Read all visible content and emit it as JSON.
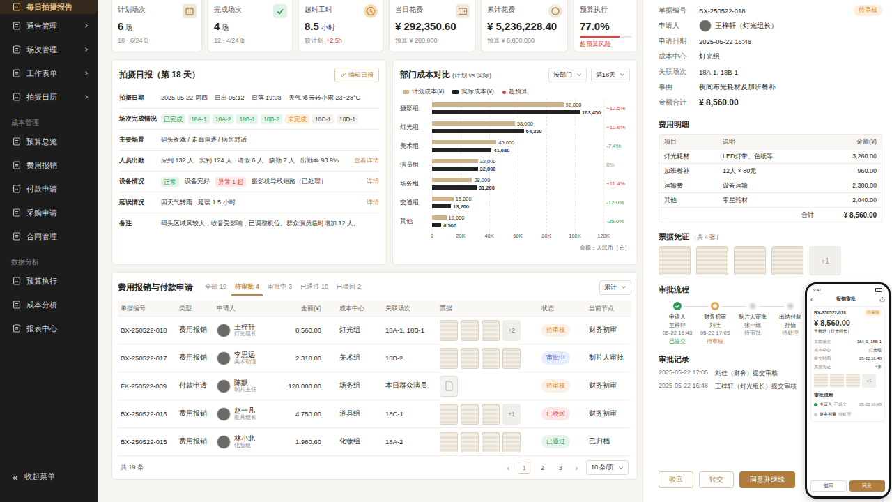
{
  "sidebar": {
    "top_items": [
      {
        "label": "每日拍摄报告",
        "selected": true,
        "expandable": false
      },
      {
        "label": "通告管理",
        "selected": false,
        "expandable": true
      },
      {
        "label": "场次管理",
        "selected": false,
        "expandable": true
      },
      {
        "label": "工作表单",
        "selected": false,
        "expandable": true
      },
      {
        "label": "拍摄日历",
        "selected": false,
        "expandable": true
      }
    ],
    "sections": [
      {
        "title": "成本管理",
        "items": [
          {
            "label": "预算总览",
            "selected": false,
            "expandable": false
          },
          {
            "label": "费用报销",
            "selected": false,
            "expandable": false
          },
          {
            "label": "付款申请",
            "selected": false,
            "expandable": false
          },
          {
            "label": "采购申请",
            "selected": false,
            "expandable": false
          },
          {
            "label": "合同管理",
            "selected": false,
            "expandable": false
          }
        ]
      },
      {
        "title": "数据分析",
        "items": [
          {
            "label": "预算执行",
            "selected": false,
            "expandable": false
          },
          {
            "label": "成本分析",
            "selected": false,
            "expandable": false
          },
          {
            "label": "报表中心",
            "selected": false,
            "expandable": false
          }
        ]
      }
    ],
    "collapse": {
      "icon": "«",
      "label": "收起菜单"
    }
  },
  "stats": [
    {
      "label": "计划场次",
      "value": "6",
      "unit": "场",
      "sub": "18 · 6/24页",
      "kind": "calendar"
    },
    {
      "label": "完成场次",
      "value": "4",
      "unit": "场",
      "sub": "12 · 4/24页",
      "kind": "check"
    },
    {
      "label": "超时工时",
      "value": "8.5",
      "unit": "小时",
      "sub": "较计划",
      "delta": "+2.5h",
      "kind": "clock"
    },
    {
      "label": "当日花费",
      "value": "¥ 292,350.60",
      "sub": "预算 ¥ 280,000",
      "kind": "wallet"
    },
    {
      "label": "累计花费",
      "value": "¥ 5,236,228.40",
      "sub": "预算 ¥ 6,800,000",
      "kind": "coin"
    },
    {
      "label": "预算执行",
      "value": "77.0%",
      "sub": "超预算风险",
      "kind": "progress",
      "level": 0.77,
      "warn": true
    }
  ],
  "report": {
    "title": "拍摄日报（第 18 天）",
    "edit_button": "编辑日报",
    "rows": [
      {
        "label": "拍摄日期",
        "kind": "text",
        "parts": [
          "2025-05-22 周四",
          "日出 05:12",
          "日落 19:08",
          "天气 多云转小雨 23~28°C"
        ]
      },
      {
        "label": "场次完成情况",
        "kind": "scenes",
        "groups": [
          {
            "status": "已完成",
            "done": true,
            "scenes": [
              "18A-1",
              "18A-2",
              "18B-1",
              "18B-2"
            ]
          },
          {
            "status": "未完成",
            "done": false,
            "scenes": [
              "18C-1",
              "18D-1"
            ]
          }
        ]
      },
      {
        "label": "主要场景",
        "kind": "text",
        "parts": [
          "码头夜戏 / 走廊追逐 / 病房对话"
        ]
      },
      {
        "label": "人员出勤",
        "kind": "text",
        "parts": [
          "应到 132 人",
          "实到 124 人",
          "请假 6 人",
          "缺勤 2 人",
          "出勤率 93.9%"
        ],
        "link": "查看详情"
      },
      {
        "label": "设备情况",
        "kind": "equipment",
        "items": [
          {
            "tag": "正常",
            "ok": true,
            "text": "设备完好"
          },
          {
            "tag": "异常 1 起",
            "ok": false,
            "text": "摄影机导线短路（已处理）"
          }
        ],
        "link": "详情"
      },
      {
        "label": "延误情况",
        "kind": "text",
        "parts": [
          "因天气转雨",
          "延误 1.5 小时"
        ],
        "link": "详情"
      },
      {
        "label": "备注",
        "kind": "text",
        "parts": [
          "码头区域风较大，收音受影响，已调整机位。群众演员临时增加 12 人。"
        ]
      }
    ]
  },
  "chart": {
    "title": "部门成本对比",
    "subtitle": "(计划 vs 实际)",
    "filters": [
      "按部门",
      "第18天"
    ],
    "legend": {
      "plan": "计划成本(¥)",
      "actual": "实际成本(¥)",
      "over": "超预算"
    },
    "axis": {
      "max": 120000,
      "ticks": [
        "0",
        "20K",
        "40K",
        "60K",
        "80K",
        "100K",
        "120K"
      ],
      "unit": "金额：人民币（元）"
    },
    "categories": [
      "摄影组",
      "灯光组",
      "美术组",
      "演员组",
      "场务组",
      "交通组",
      "其他"
    ],
    "plan": [
      92000,
      58000,
      45000,
      32000,
      28000,
      15000,
      10000
    ],
    "actual": [
      103450,
      64320,
      41680,
      32000,
      31200,
      13200,
      6500
    ],
    "plan_labels": [
      "92,000",
      "58,000",
      "45,000",
      "32,000",
      "28,000",
      "15,000",
      "10,000"
    ],
    "actual_labels": [
      "103,450",
      "64,320",
      "41,680",
      "32,000",
      "31,200",
      "13,200",
      "6,500"
    ],
    "deltas": [
      {
        "text": "+12.5%",
        "color": "#d64545"
      },
      {
        "text": "+10.9%",
        "color": "#d64545"
      },
      {
        "text": "-7.4%",
        "color": "#2f9a55"
      },
      {
        "text": "0%",
        "color": "#888888"
      },
      {
        "text": "+11.4%",
        "color": "#d64545"
      },
      {
        "text": "-12.0%",
        "color": "#2f9a55"
      },
      {
        "text": "-35.0%",
        "color": "#2f9a55"
      }
    ]
  },
  "table": {
    "title": "费用报销与付款申请",
    "tabs": [
      {
        "label": "全部",
        "count": "19",
        "selected": false
      },
      {
        "label": "待审批",
        "count": "4",
        "selected": true
      },
      {
        "label": "审批中",
        "count": "3",
        "selected": false
      },
      {
        "label": "已通过",
        "count": "10",
        "selected": false
      },
      {
        "label": "已驳回",
        "count": "2",
        "selected": false
      }
    ],
    "filter": "累计",
    "columns": [
      "单据编号",
      "类型",
      "申请人",
      "金额(¥)",
      "成本中心",
      "关联场次",
      "票据",
      "状态",
      "当前节点"
    ],
    "rows": [
      {
        "id": "BX-250522-018",
        "type": "费用报销",
        "name": "王梓轩",
        "role": "灯光组长",
        "amount": "8,560.00",
        "center": "灯光组",
        "scenes": "18A-1, 18B-1",
        "receipt_kind": "photo",
        "receipts": 3,
        "more": "+2",
        "status": "待审核",
        "color": "#e08a2a",
        "node": "财务初审"
      },
      {
        "id": "BX-250522-017",
        "type": "费用报销",
        "name": "李思远",
        "role": "美术助理",
        "amount": "2,318.00",
        "center": "美术组",
        "scenes": "18B-2",
        "receipt_kind": "photo",
        "receipts": 4,
        "status": "审批中",
        "color": "#3b6fd6",
        "node": "制片人审批"
      },
      {
        "id": "FK-250522-009",
        "type": "付款申请",
        "name": "陈默",
        "role": "制片主任",
        "amount": "120,000.00",
        "center": "场务组",
        "scenes": "本日群众演员",
        "receipt_kind": "file",
        "receipts": 1,
        "status": "待审核",
        "color": "#e08a2a",
        "node": "财务初审"
      },
      {
        "id": "BX-250522-016",
        "type": "费用报销",
        "name": "赵一凡",
        "role": "道具组长",
        "amount": "4,750.00",
        "center": "道具组",
        "scenes": "18C-1",
        "receipt_kind": "photo",
        "receipts": 3,
        "more": "+1",
        "status": "已驳回",
        "color": "#d64545",
        "node": "财务初审"
      },
      {
        "id": "BX-250522-015",
        "type": "费用报销",
        "name": "林小北",
        "role": "化妆组",
        "amount": "1,980.60",
        "center": "化妆组",
        "scenes": "18A-2",
        "receipt_kind": "photo",
        "receipts": 4,
        "status": "已通过",
        "color": "#2f9a55",
        "node": "已归档"
      }
    ],
    "footer": {
      "total": "共 19 条",
      "prev": "‹",
      "next": "›",
      "pages": [
        {
          "label": "1",
          "selected": true
        },
        {
          "label": "2",
          "selected": false
        },
        {
          "label": "3",
          "selected": false
        }
      ],
      "page_size": "10 条/页"
    }
  },
  "detail": {
    "fields": [
      {
        "label": "单据编号",
        "value": "BX-250522-018",
        "badge": "待审核"
      },
      {
        "label": "申请人",
        "value": "王梓轩（灯光组长）",
        "avatar": true
      },
      {
        "label": "申请日期",
        "value": "2025-05-22 16:48"
      },
      {
        "label": "成本中心",
        "value": "灯光组"
      },
      {
        "label": "关联场次",
        "value": "18A-1, 18B-1"
      },
      {
        "label": "事由",
        "value": "夜间布光耗材及加班餐补"
      },
      {
        "label": "金额合计",
        "value": "¥ 8,560.00",
        "emphasis": true
      }
    ],
    "items_title": "费用明细",
    "items_columns": [
      "项目",
      "说明",
      "金额(¥)"
    ],
    "items": [
      [
        "灯光耗材",
        "LED灯带、色纸等",
        "3,260.00"
      ],
      [
        "加班餐补",
        "12人 × 80元",
        "960.00"
      ],
      [
        "运输费",
        "设备运输",
        "2,300.00"
      ],
      [
        "其他",
        "零星耗材",
        "2,040.00"
      ]
    ],
    "total_label": "合计",
    "total": "¥ 8,560.00",
    "receipts_title": "票据凭证",
    "receipts_count": "（共 4 张）",
    "receipts": 4,
    "receipts_more": "+1",
    "flow_title": "审批流程",
    "flow": [
      {
        "role": "申请人",
        "name": "王梓轩",
        "time": "05-22 16:48",
        "status": "已提交",
        "state": "done"
      },
      {
        "role": "财务初审",
        "name": "刘佳",
        "time": "05-22 17:05",
        "status": "待审核",
        "state": "current"
      },
      {
        "role": "制片人审批",
        "name": "张一燃",
        "status": "待审批",
        "state": "pending"
      },
      {
        "role": "出纳付款",
        "name": "孙怡",
        "status": "待处理",
        "state": "pending"
      }
    ],
    "log_title": "审批记录",
    "log": [
      {
        "time": "2025-05-22 17:05",
        "text": "刘佳（财务）提交审核"
      },
      {
        "time": "2025-05-22 16:48",
        "text": "王梓轩（灯光组长）提交审核"
      }
    ],
    "actions": [
      {
        "label": "驳回",
        "primary": false
      },
      {
        "label": "转交",
        "primary": false
      },
      {
        "label": "同意并继续",
        "primary": true
      }
    ]
  },
  "phone": {
    "time": "9:41",
    "back": "‹",
    "title": "报销审批",
    "id": "BX-250522-018",
    "badge": "待审核",
    "amount": "¥ 8,560.00",
    "applicant": "王梓轩（灯光组长）",
    "rows": [
      [
        "关联场次",
        "18A-1, 18B-1"
      ],
      [
        "成本中心",
        "灯光组"
      ],
      [
        "提交时间",
        "05-22 16:48"
      ],
      [
        "票据凭证",
        "4张"
      ]
    ],
    "thumbs": 3,
    "more": "+1",
    "flow_title": "审批流程",
    "flow": [
      {
        "role": "申请人",
        "status": "已提交",
        "time": "05-22 16:48",
        "done": true
      },
      {
        "role": "财务初审",
        "status": "待处理",
        "done": false
      }
    ],
    "actions": [
      {
        "label": "驳回",
        "primary": false
      },
      {
        "label": "同意",
        "primary": true
      }
    ]
  }
}
